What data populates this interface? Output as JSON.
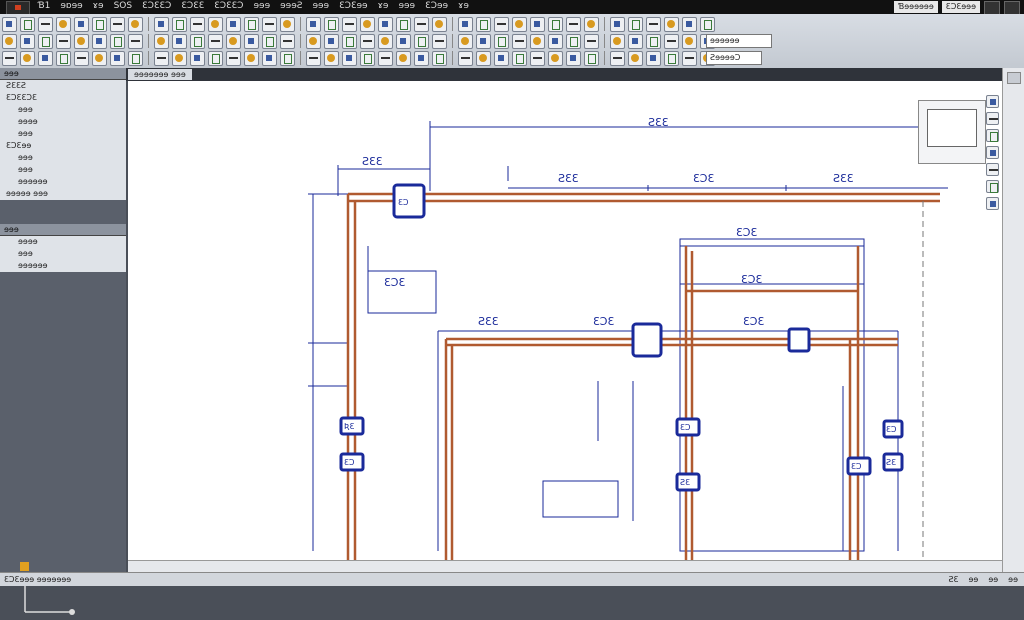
{
  "app": {
    "menu": [
      "Ɓ1",
      "ɘɒɘɘ",
      "ɤɘ",
      "SOS",
      "ƐƆƐƐƆ",
      "ƐƆƐƐ",
      "ƐƆƐƐƆ",
      "ɘɘɘ",
      "ɘɘɘƧ",
      "ɘɘɘ",
      "ƐƆƐɘɘ",
      "ɤɘ",
      "ɘɘɘ",
      "ƐƆɘɘ",
      "ɤɘ"
    ],
    "title_right": "Ɓɘɘɘɘɘɘ",
    "workspace": "ƐƆƐɘɘɘ"
  },
  "toolbar": {
    "layer_field": "ɘɘɘɘɘɘ",
    "style_field": "ƧɘɘɘɘƆ"
  },
  "tab": {
    "label": "ɘɘɘɘɘɘɘ ɘɘɘ"
  },
  "left_panel": {
    "header": "ɘɘɘ",
    "items": [
      {
        "label": "ƧƐƐƧ",
        "indent": false
      },
      {
        "label": "ƐƆƐƐƆƐ",
        "indent": false
      },
      {
        "label": "ɘɘɘ",
        "indent": true
      },
      {
        "label": "ɘɘɘɘ",
        "indent": true
      },
      {
        "label": "ɘɘɘ",
        "indent": true
      },
      {
        "label": "ƐƆƐɘɘ",
        "indent": false
      },
      {
        "label": "ɘɘɘ",
        "indent": true
      },
      {
        "label": "ɘɘɘ",
        "indent": true
      },
      {
        "label": "ɘɘɘɘɘɘ",
        "indent": true
      },
      {
        "label": "ɘɘɘɘɘ ɘɘɘ",
        "indent": false
      }
    ],
    "header2": "ɘɘɘ",
    "items2": [
      {
        "label": "ɘɘɘɘ",
        "indent": true
      },
      {
        "label": "ɘɘɘ",
        "indent": true
      },
      {
        "label": "ɘɘɘɘɘɘ",
        "indent": true
      }
    ]
  },
  "drawing": {
    "dims": [
      "ƧƐƐ",
      "ƧƐƐ",
      "ƧƐƐ",
      "ƐƆƐ",
      "ƧƐƐ",
      "ƐƆƐ",
      "ƐƆƐ",
      "ƧƐƐ",
      "ƐƆƐ",
      "ƐƆƐ",
      "ƐƆƐ"
    ],
    "tags": [
      "ƦƐ",
      "ƐƆ",
      "ƐƆ",
      "ƧƐ",
      "ƐƆ",
      "ƐƆ",
      "ƧƐ",
      "ƐƆ"
    ]
  },
  "status": {
    "coords": "ƐƆƐɘɘɘ ɘɘɘɘɘɘɘ",
    "right": [
      "ƧƐ",
      "ɘɘ",
      "ɘɘ",
      "ɘɘ"
    ]
  }
}
